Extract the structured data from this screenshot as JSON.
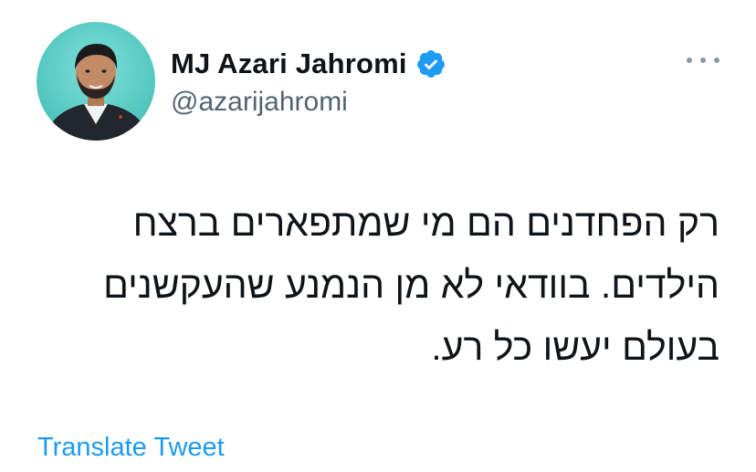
{
  "author": {
    "display_name": "MJ Azari Jahromi",
    "handle": "@azarijahromi",
    "verified": true,
    "avatar": "profile-photo"
  },
  "tweet": {
    "lines": [
      "רק הפחדנים הם מי שמתפארים ברצח",
      "הילדים. בוודאי לא מן הנמנע שהעקשנים",
      "בעולם יעשו כל רע."
    ]
  },
  "actions": {
    "more_icon": "more-horizontal-icon",
    "translate_label": "Translate Tweet"
  },
  "colors": {
    "accent": "#1d9bf0",
    "text_primary": "#0f1419",
    "text_secondary": "#536471",
    "avatar_background": "#56c9c2"
  }
}
